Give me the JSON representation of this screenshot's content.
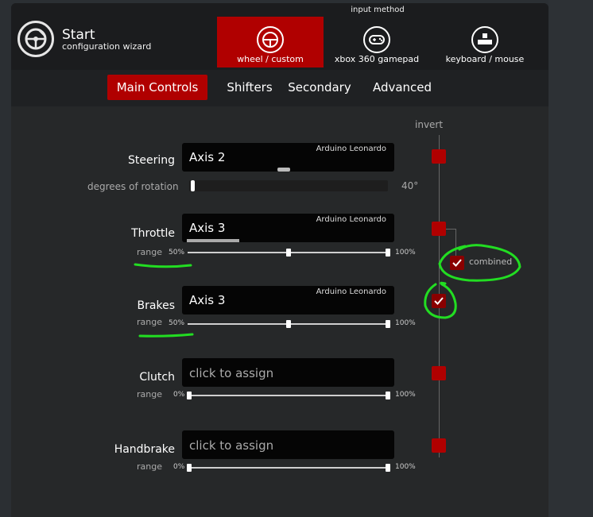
{
  "header": {
    "title": "Start",
    "subtitle": "configuration wizard",
    "input_method_label": "input method",
    "modes": [
      {
        "label": "wheel / custom",
        "icon": "steering-wheel-icon",
        "active": true
      },
      {
        "label": "xbox 360 gamepad",
        "icon": "gamepad-icon",
        "active": false
      },
      {
        "label": "keyboard / mouse",
        "icon": "keyboard-icon",
        "active": false
      }
    ]
  },
  "tabs": [
    {
      "label": "Main Controls",
      "active": true
    },
    {
      "label": "Shifters",
      "active": false
    },
    {
      "label": "Secondary",
      "active": false
    },
    {
      "label": "Advanced",
      "active": false
    }
  ],
  "invert_label": "invert",
  "controls": {
    "steering": {
      "label": "Steering",
      "axis": "Axis 2",
      "device": "Arduino Leonardo",
      "rotation_label": "degrees of rotation",
      "rotation_value": "40°"
    },
    "throttle": {
      "label": "Throttle",
      "axis": "Axis 3",
      "device": "Arduino Leonardo",
      "range_label": "range",
      "min_pct": "50%",
      "max_pct": "100%",
      "combined_label": "combined"
    },
    "brakes": {
      "label": "Brakes",
      "axis": "Axis 3",
      "device": "Arduino Leonardo",
      "range_label": "range",
      "min_pct": "50%",
      "max_pct": "100%"
    },
    "clutch": {
      "label": "Clutch",
      "assign": "click to assign",
      "range_label": "range",
      "min_pct": "0%",
      "max_pct": "100%"
    },
    "handbrake": {
      "label": "Handbrake",
      "assign": "click to assign",
      "range_label": "range",
      "min_pct": "0%",
      "max_pct": "100%"
    }
  },
  "colors": {
    "accent": "#b00000",
    "annotation": "#22dd22"
  }
}
